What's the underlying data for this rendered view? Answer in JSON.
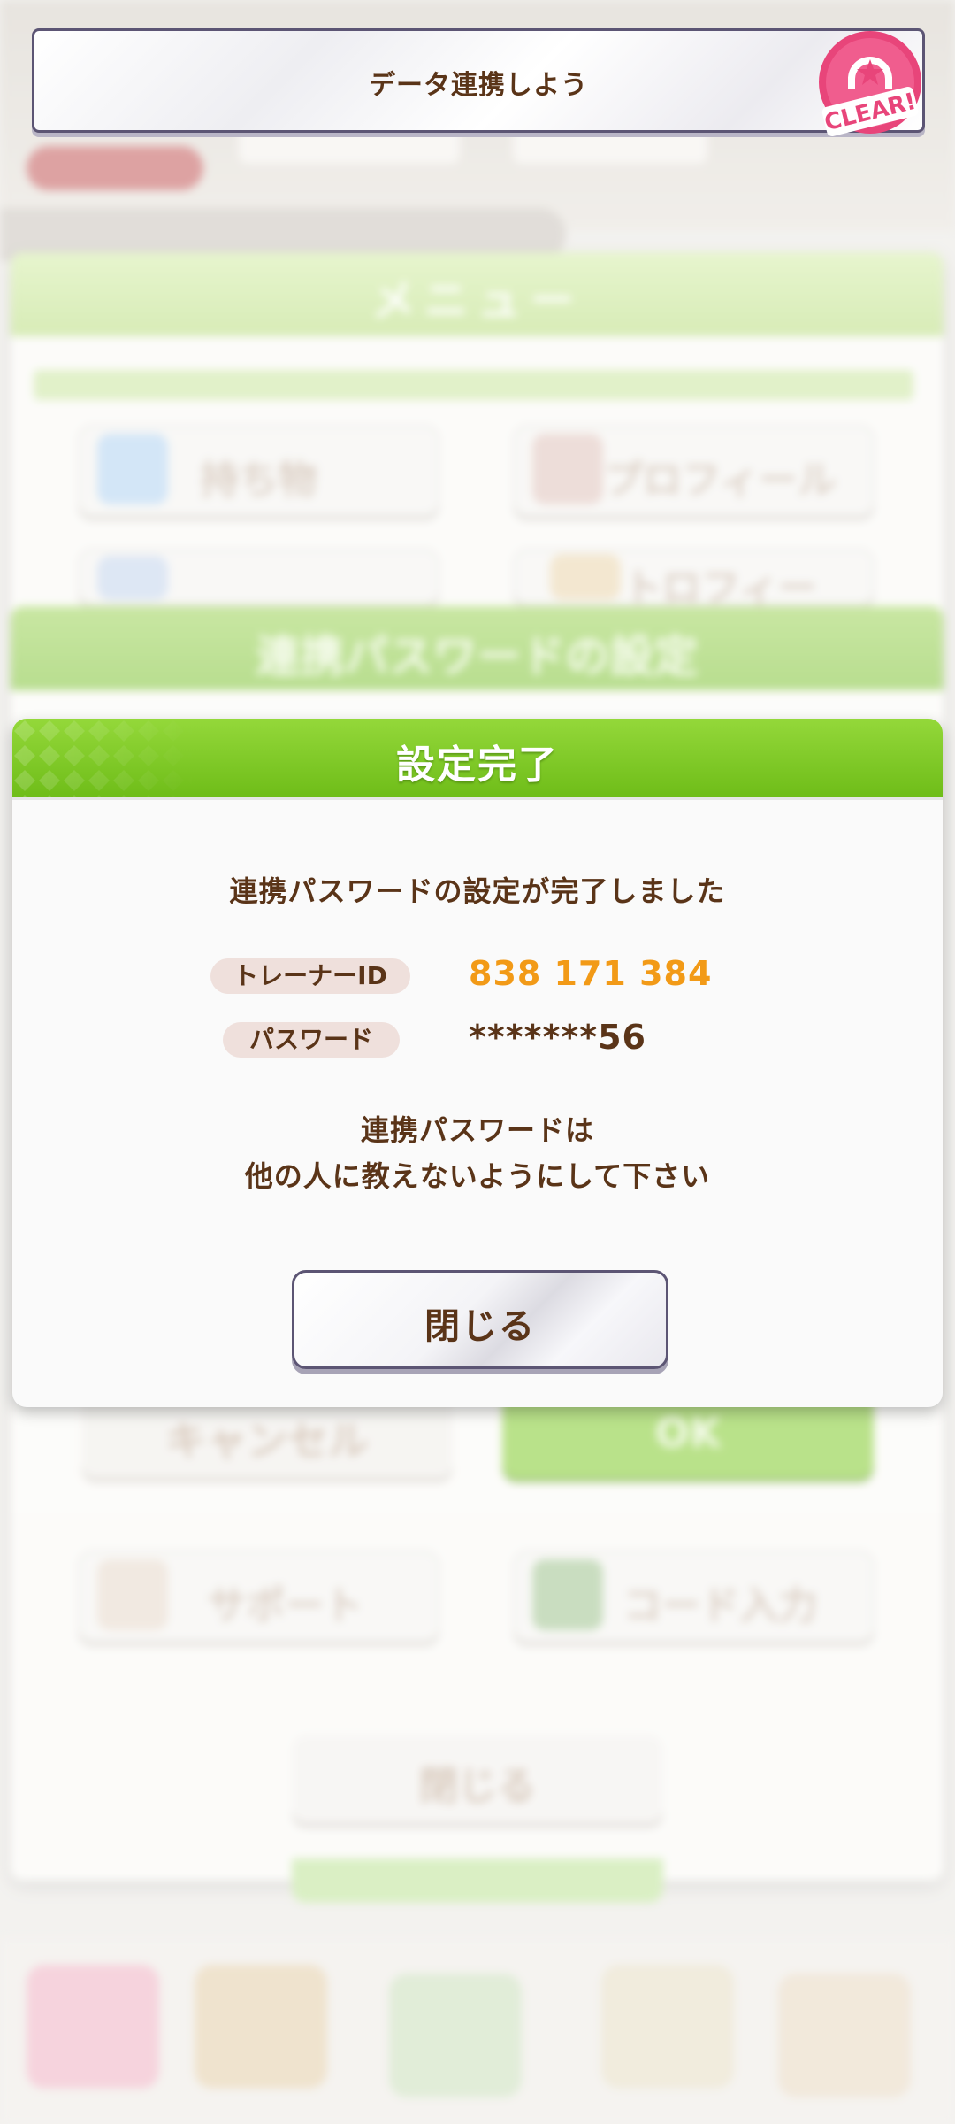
{
  "mission_banner": {
    "label": "データ連携しよう",
    "badge_text": "CLEAR!"
  },
  "background": {
    "menu_title": "メニュー",
    "menu_buttons": [
      "持ち物",
      "プロフィール",
      "",
      "トロフィー",
      "サポート",
      "コード入力"
    ],
    "password_panel_title": "連携パスワードの設定",
    "cancel_label": "キャンセル",
    "ok_label": "OK",
    "close_label": "閉じる"
  },
  "dialog": {
    "title": "設定完了",
    "message": "連携パスワードの設定が完了しました",
    "trainer_id_label": "トレーナーID",
    "trainer_id_value": "838 171 384",
    "password_label": "パスワード",
    "password_value": "*******56",
    "warning_line1": "連携パスワードは",
    "warning_line2": "他の人に教えないようにして下さい",
    "close_button": "閉じる"
  },
  "colors": {
    "header_green": "#7cc823",
    "text_brown": "#5a3418",
    "id_orange": "#f29a17",
    "badge_pink": "#e8457a"
  }
}
